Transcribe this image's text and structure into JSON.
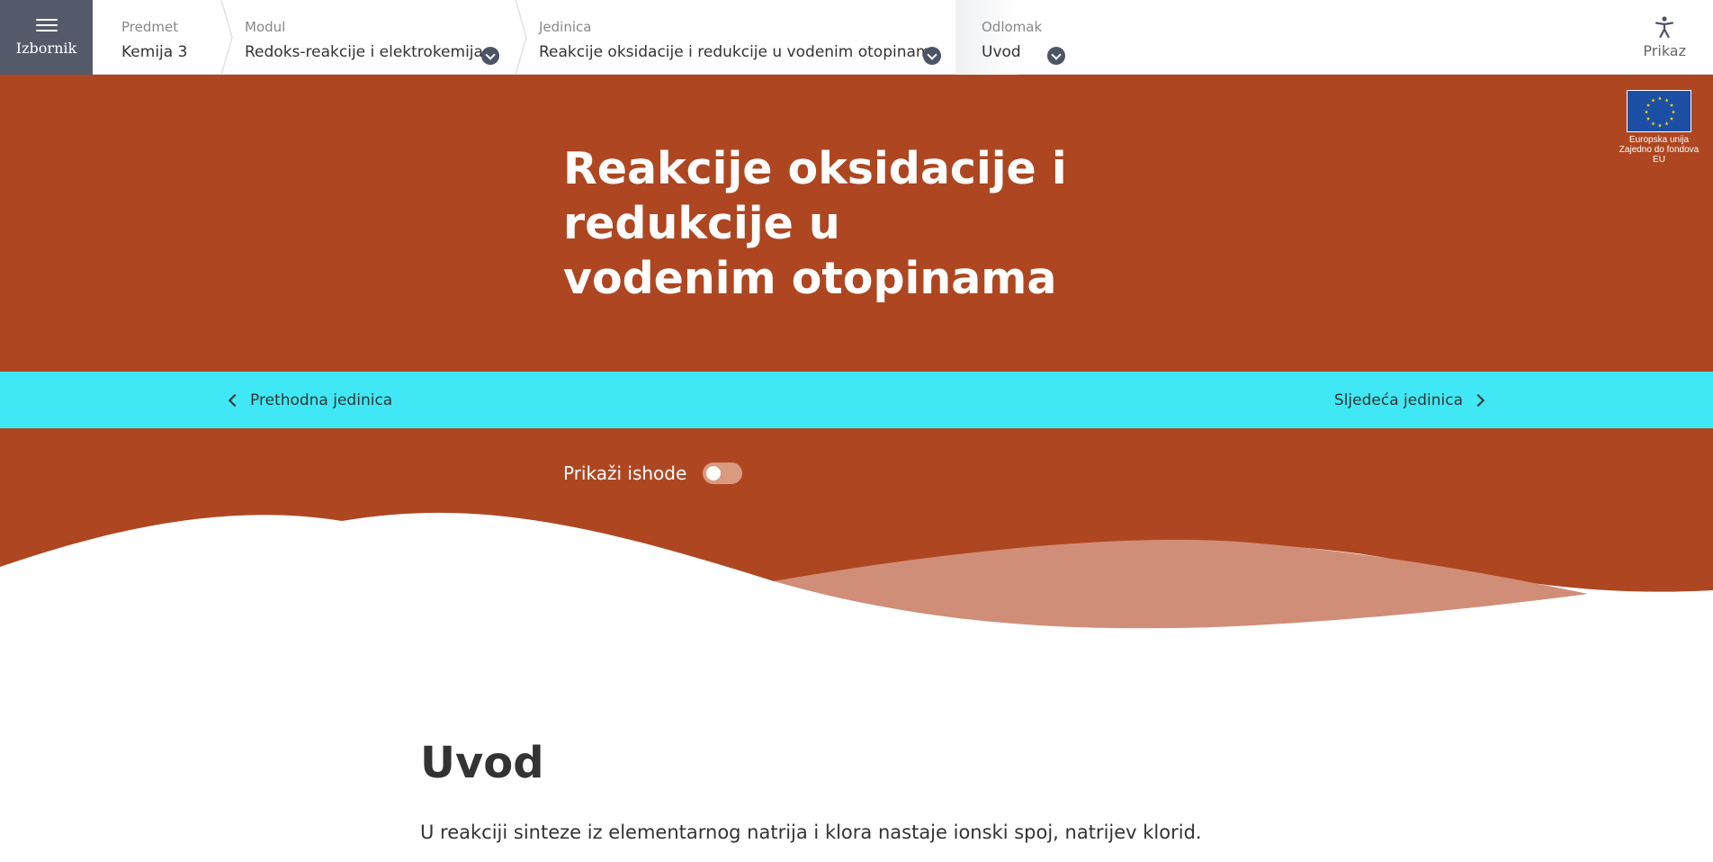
{
  "menu": {
    "label": "Izbornik"
  },
  "breadcrumbs": [
    {
      "label": "Predmet",
      "value": "Kemija 3"
    },
    {
      "label": "Modul",
      "value": "Redoks-reakcije i elektrokemija"
    },
    {
      "label": "Jedinica",
      "value": "Reakcije oksidacije i redukcije u vodenim otopinama"
    },
    {
      "label": "Odlomak",
      "value": "Uvod"
    }
  ],
  "accessibility": {
    "label": "Prikaz",
    "icon": "accessibility-icon"
  },
  "hero": {
    "title": "Reakcije oksidacije i redukcije u vodenim otopinama",
    "eu_logo": {
      "line1": "Europska unija",
      "line2": "Zajedno do fondova EU"
    }
  },
  "unit_nav": {
    "prev_label": "Prethodna jedinica",
    "next_label": "Sljedeća jedinica"
  },
  "outcomes": {
    "label": "Prikaži ishode",
    "enabled": false
  },
  "content": {
    "title": "Uvod",
    "paragraph": "U reakciji sinteze iz elementarnog natrija i klora nastaje ionski spoj, natrijev klorid."
  },
  "colors": {
    "hero_bg": "#ae4721",
    "unit_nav_bg": "#3fe8f4",
    "menu_bg": "#555a6b",
    "wave_light": "#d08e78"
  }
}
